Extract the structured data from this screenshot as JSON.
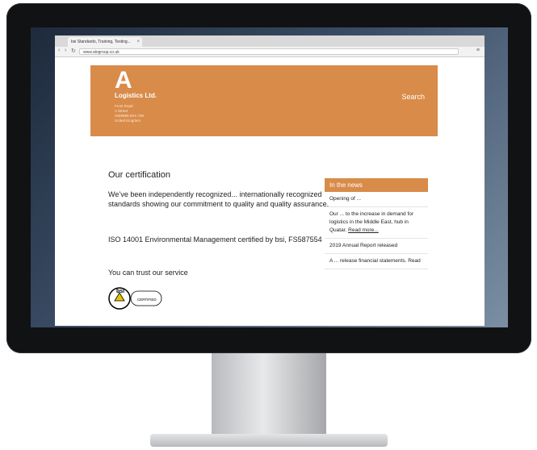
{
  "browser": {
    "tab_title": "bsi Standards, Training, Testing...",
    "tab_close": "×",
    "back": "‹",
    "forward": "›",
    "reload": "↻",
    "url": "www.alogroup.co.uk",
    "menu": "≡"
  },
  "site": {
    "logo_letter": "A",
    "company": "Logistics Ltd.",
    "address_lines": [
      "Front Road",
      "A Street",
      "HW9999 9XX 700",
      "United Kingdom"
    ],
    "search": "Search"
  },
  "content": {
    "heading": "Our certification",
    "para1": "We’ve been independently recognized... internationally recognized standards showing our commitment to quality and quality assurance.",
    "para2": "ISO 14001 Environmental Management certified by bsi, FS587554",
    "para3": "You can trust our service",
    "bsi_logo": "bsi",
    "bsi_certified": "CERTIFIED"
  },
  "news": {
    "heading": "In the news",
    "items": [
      {
        "text": "Opening of ...",
        "link": ""
      },
      {
        "text": "Our ... to the increase in demand for logistics in the Middle East, hub in Quatar.",
        "link": "Read more..."
      },
      {
        "text": "2019 Annual Report released",
        "link": ""
      },
      {
        "text": "A ... release financial statements. Read",
        "link": ""
      }
    ]
  }
}
